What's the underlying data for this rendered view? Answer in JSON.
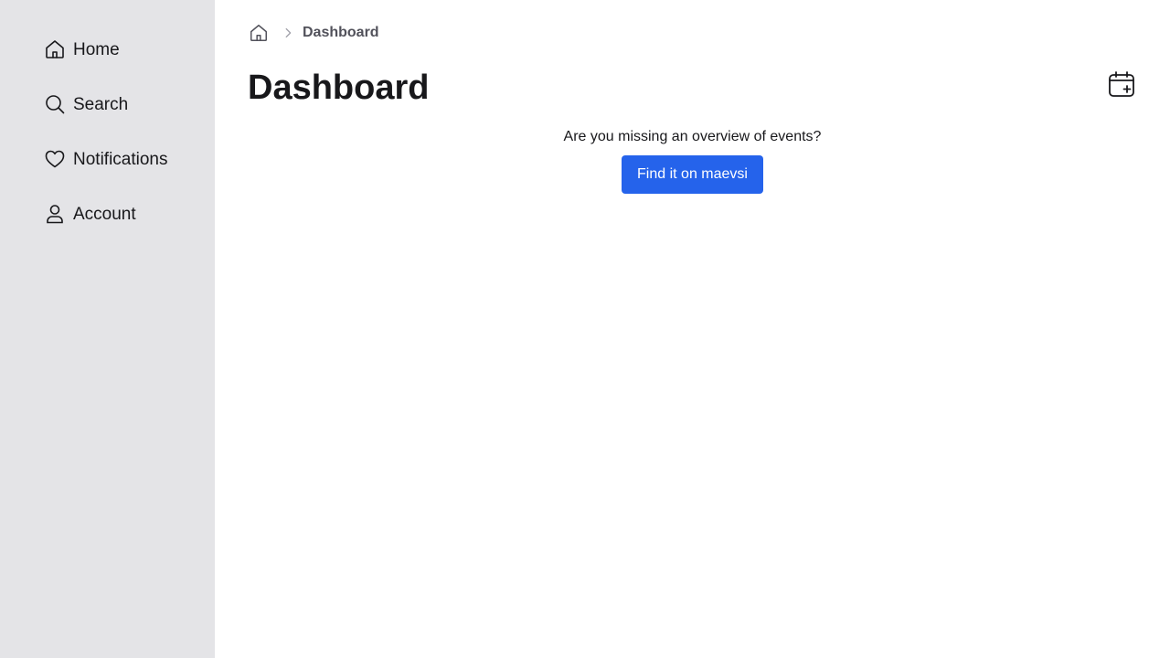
{
  "sidebar": {
    "items": [
      {
        "label": "Home",
        "icon": "home-icon"
      },
      {
        "label": "Search",
        "icon": "search-icon"
      },
      {
        "label": "Notifications",
        "icon": "heart-icon"
      },
      {
        "label": "Account",
        "icon": "user-icon"
      }
    ]
  },
  "breadcrumb": {
    "home_icon": "home-icon",
    "separator_icon": "chevron-right-icon",
    "current": "Dashboard"
  },
  "main": {
    "title": "Dashboard",
    "create_event_icon": "calendar-plus-icon",
    "overview_text": "Are you missing an overview of events?",
    "cta_label": "Find it on maevsi"
  },
  "colors": {
    "sidebar_bg": "#e4e4e7",
    "accent": "#2563eb",
    "text": "#18181b",
    "muted": "#52525b"
  }
}
